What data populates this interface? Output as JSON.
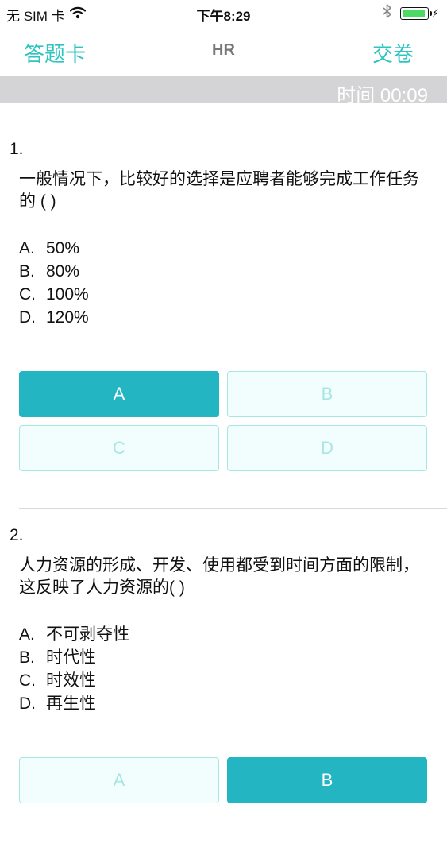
{
  "status_bar": {
    "carrier": "无 SIM 卡",
    "time": "下午8:29",
    "battery_level": 1.0,
    "battery_color": "#4cd964"
  },
  "nav": {
    "left_label": "答题卡",
    "title": "HR",
    "right_label": "交卷",
    "accent_color": "#2ec4c0"
  },
  "timer": {
    "text": "时间 00:09"
  },
  "questions": [
    {
      "number": "1.",
      "text": "一般情况下，比较好的选择是应聘者能够完成工作任务的 ( )",
      "options": [
        {
          "letter": "A.",
          "text": "50%"
        },
        {
          "letter": "B.",
          "text": "80%"
        },
        {
          "letter": "C.",
          "text": "100%"
        },
        {
          "letter": "D.",
          "text": "120%"
        }
      ],
      "answer_buttons": [
        "A",
        "B",
        "C",
        "D"
      ],
      "selected": "A"
    },
    {
      "number": "2.",
      "text": "人力资源的形成、开发、使用都受到时间方面的限制，这反映了人力资源的( )",
      "options": [
        {
          "letter": "A.",
          "text": "不可剥夺性"
        },
        {
          "letter": "B.",
          "text": "时代性"
        },
        {
          "letter": "C.",
          "text": "时效性"
        },
        {
          "letter": "D.",
          "text": "再生性"
        }
      ],
      "answer_buttons": [
        "A",
        "B"
      ],
      "selected": "B"
    }
  ],
  "colors": {
    "selected_button": "#23b5c1",
    "unselected_button_border": "#a6e6e3",
    "timer_bar": "#d4d4d6"
  },
  "icons": [
    "wifi-icon",
    "bluetooth-icon",
    "battery-icon",
    "charging-bolt-icon"
  ]
}
